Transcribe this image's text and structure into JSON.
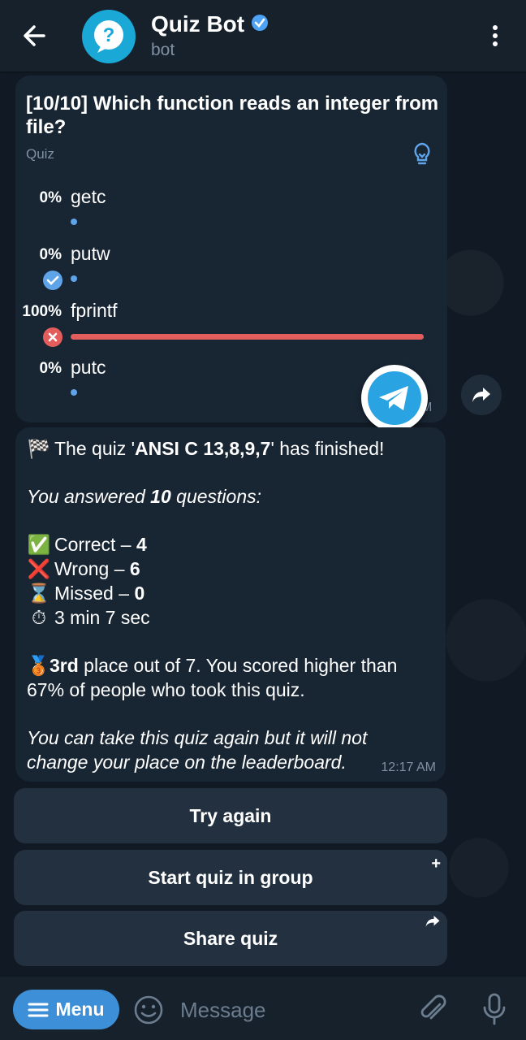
{
  "header": {
    "title": "Quiz Bot",
    "subtitle": "bot",
    "avatar_icon": "question-icon",
    "accent": "#1aa9d6",
    "verified_color": "#4fa3f7"
  },
  "poll": {
    "question": "[10/10] Which function reads an integer from file?",
    "type": "Quiz",
    "options": [
      {
        "pct": "0%",
        "label": "getc",
        "state": "none",
        "fraction": 0
      },
      {
        "pct": "0%",
        "label": "putw",
        "state": "correct",
        "fraction": 0
      },
      {
        "pct": "100%",
        "label": "fprintf",
        "state": "wrong",
        "fraction": 1
      },
      {
        "pct": "0%",
        "label": "putc",
        "state": "none",
        "fraction": 0
      }
    ],
    "time": "M",
    "wrong_color": "#e35d5d",
    "correct_color": "#5fa4e8"
  },
  "result": {
    "finished_prefix": "The quiz '",
    "quiz_name": "ANSI C 13,8,9,7",
    "finished_suffix": "' has finished!",
    "answered_prefix": "You answered ",
    "answered_count": "10",
    "answered_suffix": " questions:",
    "correct_label": "Correct – ",
    "correct_value": "4",
    "wrong_label": "Wrong – ",
    "wrong_value": "6",
    "missed_label": "Missed – ",
    "missed_value": "0",
    "duration": "3 min 7 sec",
    "place_value": "3rd",
    "place_rest": " place out of 7. You scored higher than",
    "place_line2": "67% of people who took this quiz.",
    "note_line1": "You can take this quiz again but it will not",
    "note_line2": "change your place on the leaderboard.",
    "time": "12:17 AM"
  },
  "buttons": {
    "try_again": "Try again",
    "start_group": "Start quiz in group",
    "share": "Share quiz",
    "start_group_corner": "+",
    "share_corner": "share-arrow-icon"
  },
  "bottom": {
    "menu_label": "Menu",
    "placeholder": "Message",
    "menu_color": "#3d8fd8"
  }
}
